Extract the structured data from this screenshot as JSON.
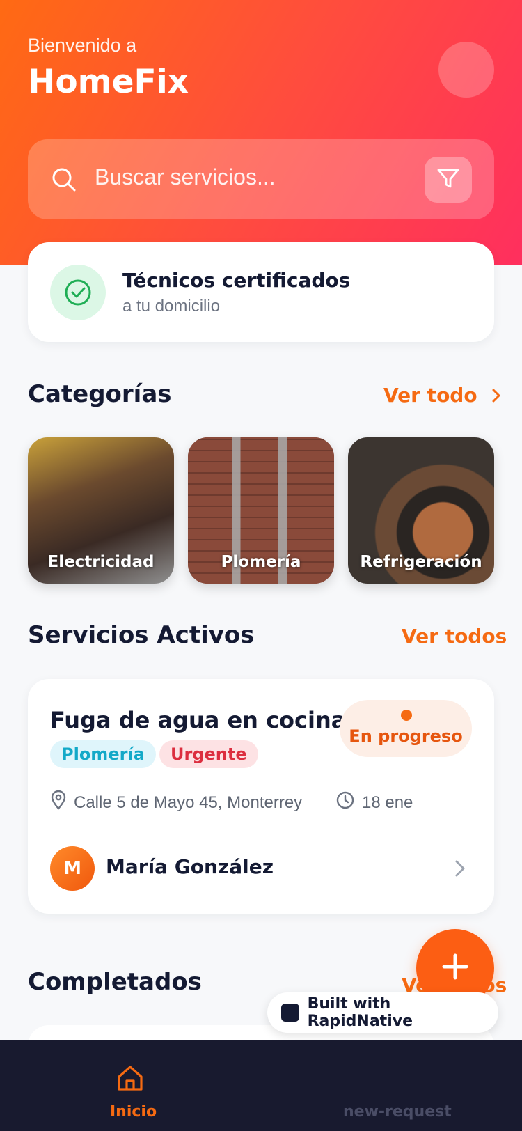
{
  "header": {
    "welcome": "Bienvenido a",
    "app_name": "HomeFix"
  },
  "search": {
    "placeholder": "Buscar servicios..."
  },
  "certified": {
    "title": "Técnicos certificados",
    "subtitle": "a tu domicilio"
  },
  "categories": {
    "title": "Categorías",
    "link": "Ver todo",
    "items": [
      {
        "label": "Electricidad"
      },
      {
        "label": "Plomería"
      },
      {
        "label": "Refrigeración"
      }
    ]
  },
  "active_services": {
    "title": "Servicios Activos",
    "link": "Ver todos",
    "card": {
      "title": "Fuga de agua en cocina",
      "status": "En progreso",
      "tags": [
        "Plomería",
        "Urgente"
      ],
      "address": "Calle 5 de Mayo 45, Monterrey",
      "date": "18 ene",
      "technician_initial": "M",
      "technician_name": "María González"
    }
  },
  "completed": {
    "title": "Completados",
    "link": "Ver todos"
  },
  "badge": {
    "text": "Built with RapidNative"
  },
  "nav": {
    "items": [
      {
        "label": "Inicio",
        "active": true
      },
      {
        "label": "new-request",
        "active": false
      }
    ]
  },
  "colors": {
    "accent": "#f56a12",
    "gradient_start": "#ff6a13",
    "gradient_end": "#ff2f5e",
    "nav_bg": "#181a2f"
  }
}
